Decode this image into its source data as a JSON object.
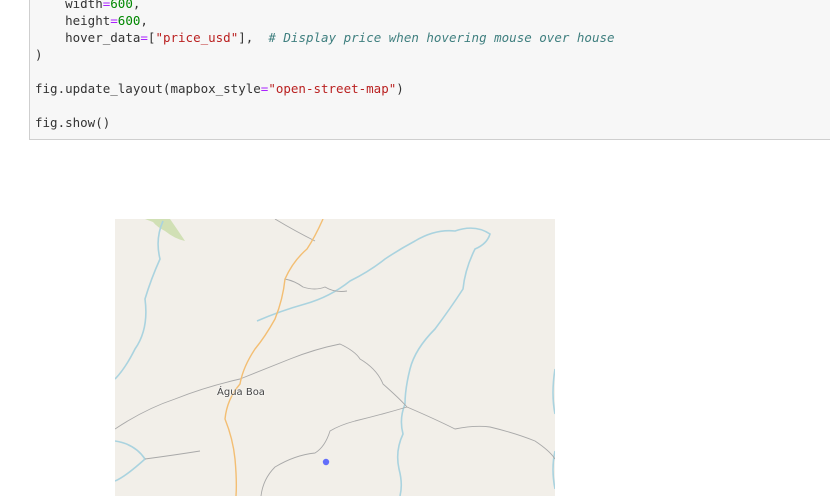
{
  "code_cell": {
    "lines": [
      {
        "indent": "    ",
        "key": "width",
        "eq": "=",
        "num": "600",
        "tail": ","
      },
      {
        "indent": "    ",
        "key": "height",
        "eq": "=",
        "num": "600",
        "tail": ","
      },
      {
        "indent": "    ",
        "key": "hover_data",
        "eq": "=",
        "open": "[",
        "str": "\"price_usd\"",
        "close": "],",
        "comment": "# Display price when hovering mouse over house"
      },
      {
        "text": ")"
      },
      {
        "text": ""
      },
      {
        "prefix": "fig.update_layout(mapbox_style",
        "eq": "=",
        "str": "\"open-street-map\"",
        "suffix": ")"
      },
      {
        "text": ""
      },
      {
        "text": "fig.show()"
      }
    ]
  },
  "map": {
    "style": "open-street-map",
    "place_label": "Água Boa",
    "marker_color": "#636efa",
    "river_color": "#aad3df",
    "road_color": "#f7c47d",
    "boundary_color": "#9a9a9a"
  }
}
